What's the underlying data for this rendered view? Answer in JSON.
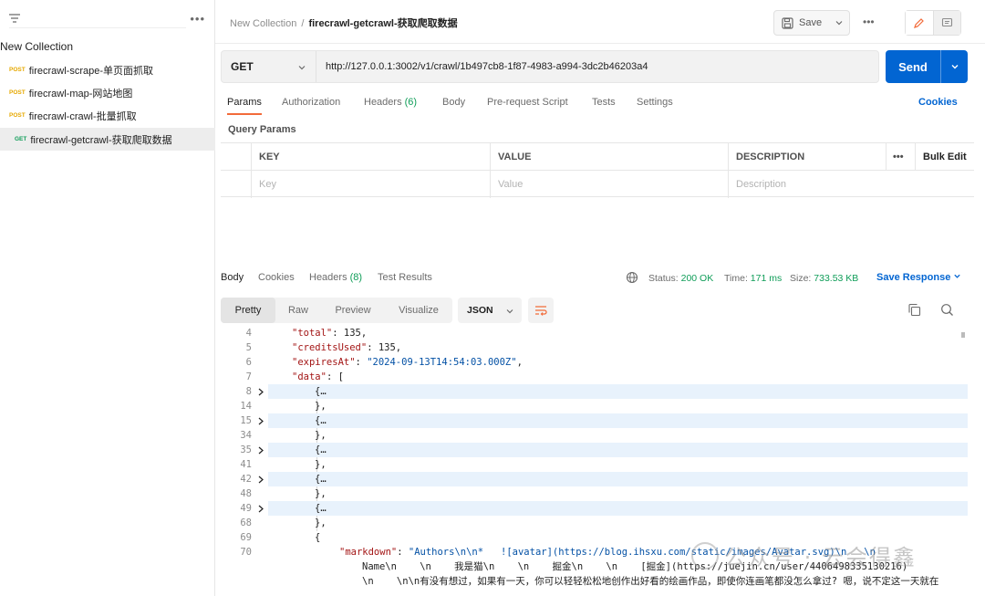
{
  "sidebar": {
    "collection_title": "New Collection",
    "requests": [
      {
        "method": "POST",
        "name": "firecrawl-scrape-单页面抓取"
      },
      {
        "method": "POST",
        "name": "firecrawl-map-网站地图"
      },
      {
        "method": "POST",
        "name": "firecrawl-crawl-批量抓取"
      },
      {
        "method": "GET",
        "name": "firecrawl-getcrawl-获取爬取数据"
      }
    ]
  },
  "header": {
    "breadcrumb_parent": "New Collection",
    "breadcrumb_sep": "/",
    "breadcrumb_current": "firecrawl-getcrawl-获取爬取数据",
    "save_label": "Save"
  },
  "request": {
    "method": "GET",
    "url": "http://127.0.0.1:3002/v1/crawl/1b497cb8-1f87-4983-a994-3dc2b46203a4",
    "send_label": "Send"
  },
  "request_tabs": {
    "params": "Params",
    "authorization": "Authorization",
    "headers": "Headers",
    "headers_count": "(6)",
    "body": "Body",
    "prerequest": "Pre-request Script",
    "tests": "Tests",
    "settings": "Settings",
    "cookies": "Cookies"
  },
  "query_params": {
    "title": "Query Params",
    "col_key": "KEY",
    "col_value": "VALUE",
    "col_description": "DESCRIPTION",
    "bulk_edit": "Bulk Edit",
    "ph_key": "Key",
    "ph_value": "Value",
    "ph_description": "Description"
  },
  "response_tabs": {
    "body": "Body",
    "cookies": "Cookies",
    "headers": "Headers",
    "headers_count": "(8)",
    "test_results": "Test Results",
    "status_label": "Status:",
    "status_value": "200 OK",
    "time_label": "Time:",
    "time_value": "171 ms",
    "size_label": "Size:",
    "size_value": "733.53 KB",
    "save_response": "Save Response"
  },
  "format_bar": {
    "pretty": "Pretty",
    "raw": "Raw",
    "preview": "Preview",
    "visualize": "Visualize",
    "format": "JSON"
  },
  "code_lines": [
    {
      "n": "4",
      "text": "\"total\": 135,"
    },
    {
      "n": "5",
      "text": "\"creditsUsed\": 135,"
    },
    {
      "n": "6",
      "text": "\"expiresAt\": \"2024-09-13T14:54:03.000Z\","
    },
    {
      "n": "7",
      "text": "\"data\": ["
    },
    {
      "n": "8",
      "text": "{…"
    },
    {
      "n": "14",
      "text": "},"
    },
    {
      "n": "15",
      "text": "{…"
    },
    {
      "n": "34",
      "text": "},"
    },
    {
      "n": "35",
      "text": "{…"
    },
    {
      "n": "41",
      "text": "},"
    },
    {
      "n": "42",
      "text": "{…"
    },
    {
      "n": "48",
      "text": "},"
    },
    {
      "n": "49",
      "text": "{…"
    },
    {
      "n": "68",
      "text": "},"
    },
    {
      "n": "69",
      "text": "{"
    },
    {
      "n": "70",
      "text": "\"markdown\": \"Authors\\n\\n*   ![avatar](https://blog.ihsxu.com/static/images/Avatar.svg)\\n   \\n"
    },
    {
      "n": "",
      "text": "Name\\n    \\n    我是猫\\n    \\n    掘金\\n    \\n    [掘金](https://juejin.cn/user/4406498335130216)"
    },
    {
      "n": "",
      "text": "\\n    \\n\\n有没有想过，如果有一天，你可以轻轻松松地创作出好看的绘画作品，即使你连画笔都没怎么拿过? 嗯，说不定这一天就在"
    }
  ],
  "watermark": "公众号 · 云会得鑫",
  "colors": {
    "accent_orange": "#f26b3a",
    "send_blue": "#0265d2",
    "status_green": "#0f9d58",
    "post_yellow": "#e6a800",
    "highlight": "#e8f2fc"
  }
}
